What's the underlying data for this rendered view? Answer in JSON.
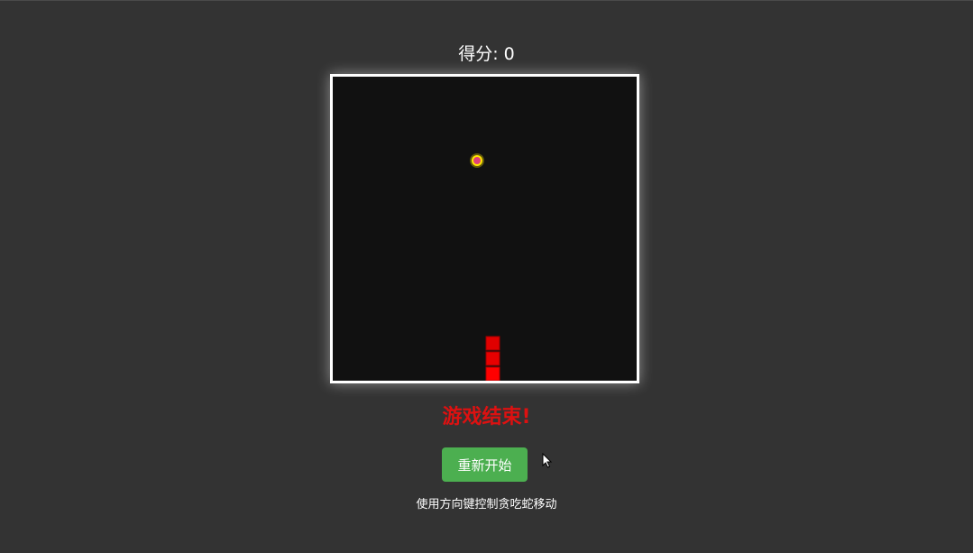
{
  "score": {
    "label": "得分: 0",
    "value": 0
  },
  "board": {
    "background_color": "#111111",
    "border_color": "#ffffff",
    "food": {
      "fill_color": "#e0407a",
      "ring_color": "#ffe600"
    },
    "snake": {
      "color": "#ff0000"
    }
  },
  "status": {
    "game_over_text": "游戏结束!",
    "color": "#dd1111"
  },
  "controls": {
    "restart_label": "重新开始",
    "restart_color": "#4caf50"
  },
  "instructions": "使用方向键控制贪吃蛇移动"
}
